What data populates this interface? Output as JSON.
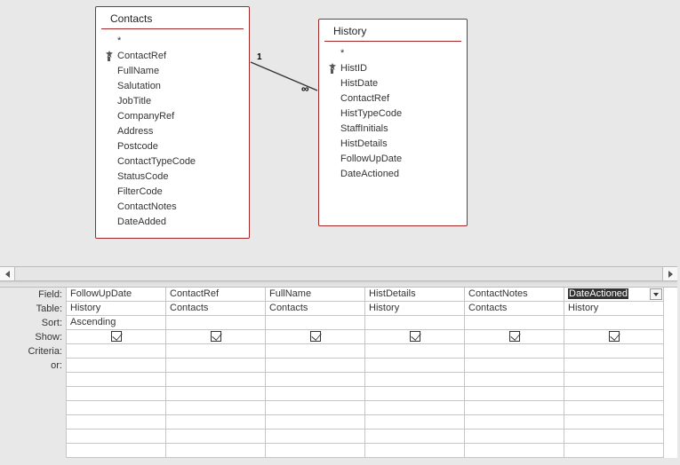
{
  "tables": {
    "contacts": {
      "title": "Contacts",
      "asterisk": "*",
      "fields": [
        "ContactRef",
        "FullName",
        "Salutation",
        "JobTitle",
        "CompanyRef",
        "Address",
        "Postcode",
        "ContactTypeCode",
        "StatusCode",
        "FilterCode",
        "ContactNotes",
        "DateAdded"
      ],
      "pkIndex": 0
    },
    "history": {
      "title": "History",
      "asterisk": "*",
      "fields": [
        "HistID",
        "HistDate",
        "ContactRef",
        "HistTypeCode",
        "StaffInitials",
        "HistDetails",
        "FollowUpDate",
        "DateActioned"
      ],
      "pkIndex": 0
    }
  },
  "relationship": {
    "one": "1",
    "many": "∞"
  },
  "gridLabels": {
    "field": "Field:",
    "table": "Table:",
    "sort": "Sort:",
    "show": "Show:",
    "criteria": "Criteria:",
    "or": "or:"
  },
  "columns": [
    {
      "field": "FollowUpDate",
      "table": "History",
      "sort": "Ascending",
      "show": true,
      "selected": false
    },
    {
      "field": "ContactRef",
      "table": "Contacts",
      "sort": "",
      "show": true,
      "selected": false
    },
    {
      "field": "FullName",
      "table": "Contacts",
      "sort": "",
      "show": true,
      "selected": false
    },
    {
      "field": "HistDetails",
      "table": "History",
      "sort": "",
      "show": true,
      "selected": false
    },
    {
      "field": "ContactNotes",
      "table": "Contacts",
      "sort": "",
      "show": true,
      "selected": false
    },
    {
      "field": "DateActioned",
      "table": "History",
      "sort": "",
      "show": true,
      "selected": true
    }
  ]
}
